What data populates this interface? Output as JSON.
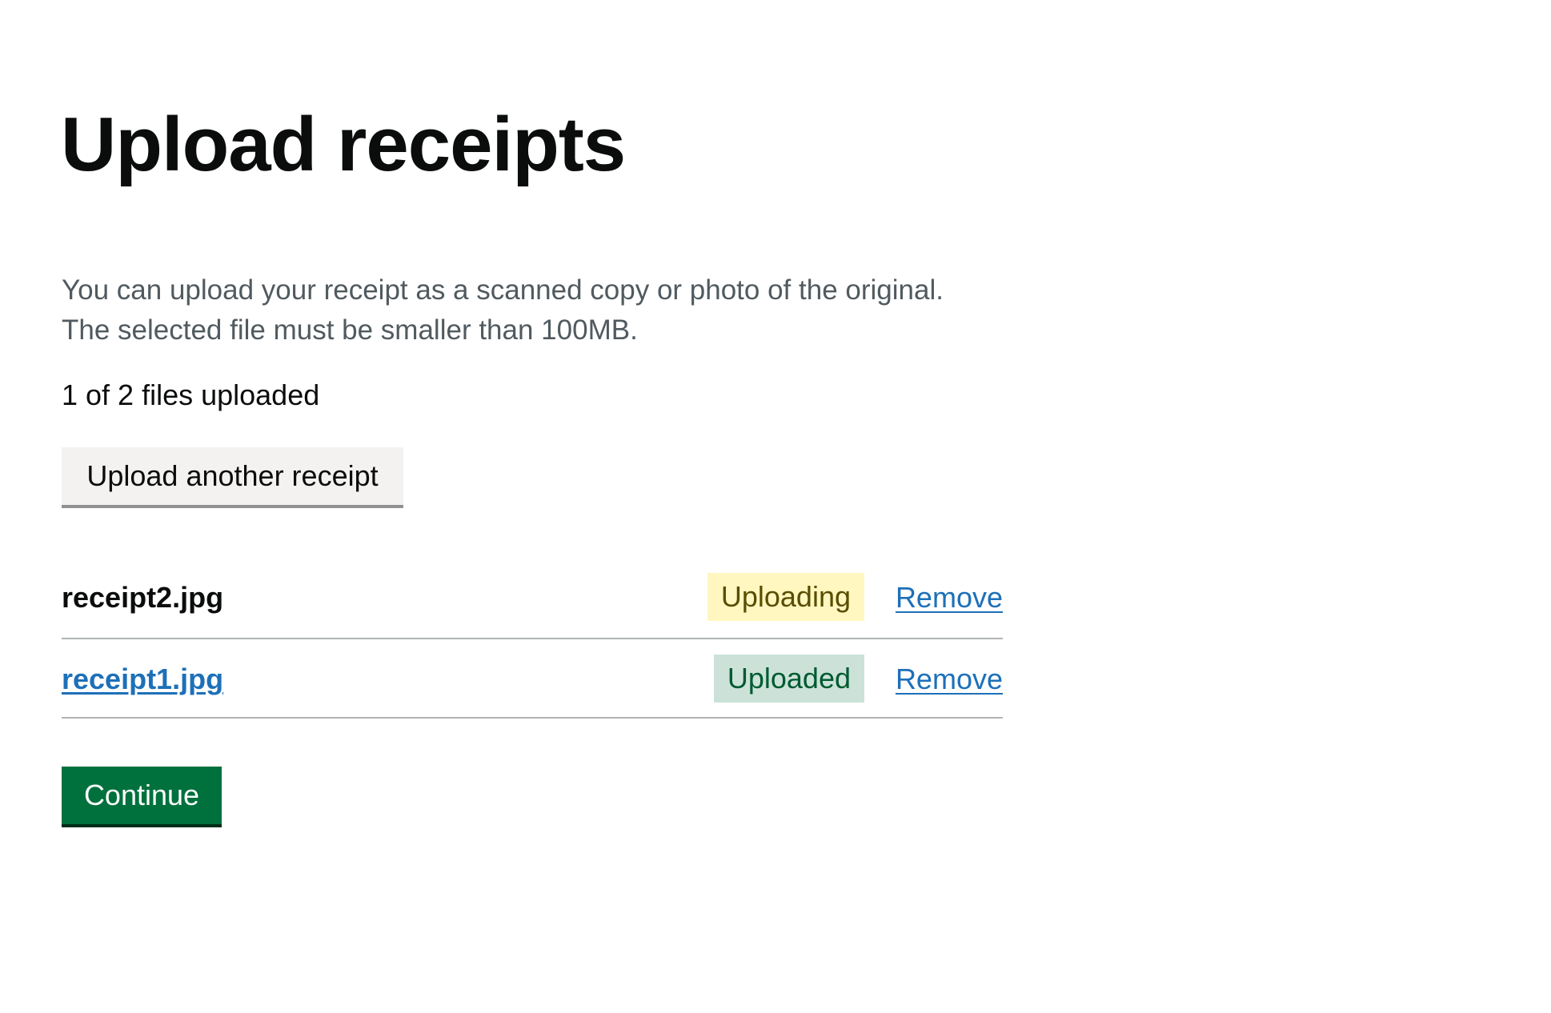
{
  "page": {
    "title": "Upload receipts",
    "hint_lines": [
      "You can upload your receipt as a scanned copy or photo of the original.",
      "The selected file must be smaller than 100MB."
    ],
    "status_count": "1 of 2 files uploaded",
    "upload_button_label": "Upload another receipt",
    "continue_button_label": "Continue"
  },
  "files": [
    {
      "name": "receipt2.jpg",
      "is_link": false,
      "status": "Uploading",
      "status_color_bg": "#fff7bf",
      "status_color_text": "#594d00",
      "remove_label": "Remove"
    },
    {
      "name": "receipt1.jpg",
      "is_link": true,
      "status": "Uploaded",
      "status_color_bg": "#cce2d8",
      "status_color_text": "#005a30",
      "remove_label": "Remove"
    }
  ],
  "colors": {
    "primary_button": "#00703c",
    "link": "#1d70b8",
    "text": "#0b0c0c",
    "secondary_text": "#505a5f",
    "divider": "#b1b4b6",
    "secondary_button": "#f3f2f1"
  }
}
